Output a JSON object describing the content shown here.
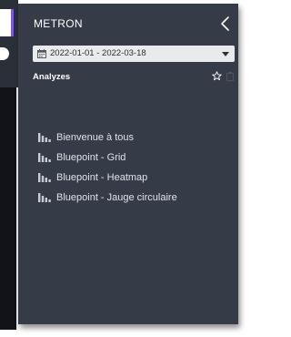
{
  "app": {
    "title": "METRON"
  },
  "date_filter": {
    "value": "2022-01-01 - 2022-03-18"
  },
  "section": {
    "title": "Analyzes"
  },
  "dashboards": [
    {
      "label": "Bienvenue à tous",
      "icon": "bar-chart-icon"
    },
    {
      "label": "Bluepoint - Grid",
      "icon": "bar-chart-icon"
    },
    {
      "label": "Bluepoint - Heatmap",
      "icon": "bar-chart-icon"
    },
    {
      "label": "Bluepoint - Jauge circulaire",
      "icon": "bar-chart-icon"
    }
  ],
  "colors": {
    "sidebar_bg": "#353b47",
    "accent": "#7b5cd6",
    "text": "#ffffff",
    "date_field_bg": "#e9eaec"
  }
}
